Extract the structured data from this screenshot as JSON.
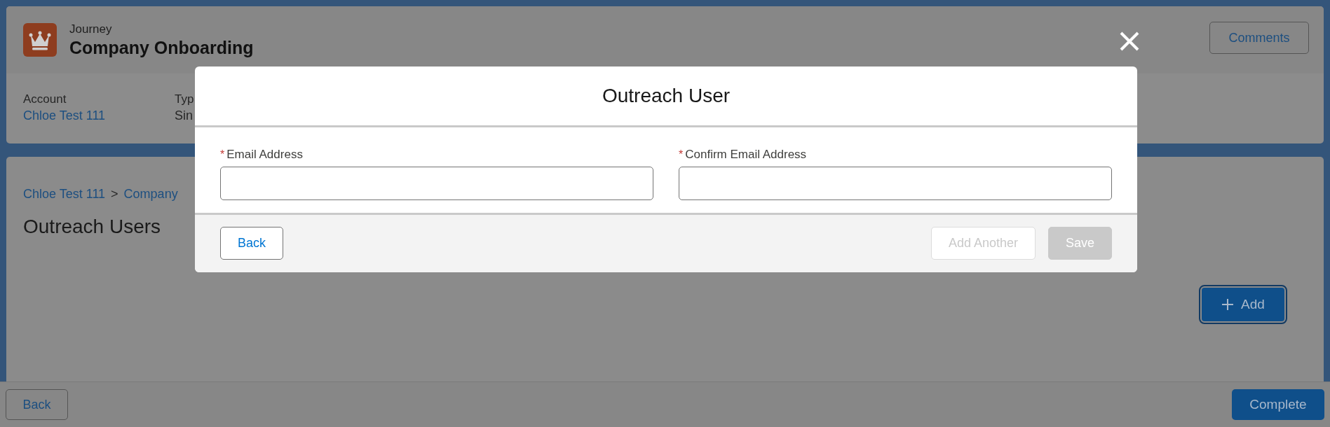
{
  "header": {
    "object_type": "Journey",
    "title": "Company Onboarding",
    "comments_button": "Comments",
    "fields": [
      {
        "label": "Account",
        "value": "Chloe Test 111",
        "kind": "link"
      },
      {
        "label": "Typ",
        "value": "Sin",
        "kind": "text"
      }
    ]
  },
  "breadcrumb": {
    "items": [
      "Chloe Test 111",
      "Company"
    ],
    "separator": ">"
  },
  "section": {
    "title": "Outreach Users",
    "add_button": "Add"
  },
  "footer": {
    "back_button": "Back",
    "complete_button": "Complete"
  },
  "modal": {
    "title": "Outreach User",
    "required_mark": "*",
    "fields": [
      {
        "label": "Email Address",
        "required": true
      },
      {
        "label": "Confirm Email Address",
        "required": true
      }
    ],
    "back_button": {
      "label": "Back",
      "disabled": false
    },
    "actions": [
      {
        "label": "Add Another",
        "disabled": true,
        "kind": "neutral"
      },
      {
        "label": "Save",
        "disabled": true,
        "kind": "brand"
      }
    ]
  }
}
